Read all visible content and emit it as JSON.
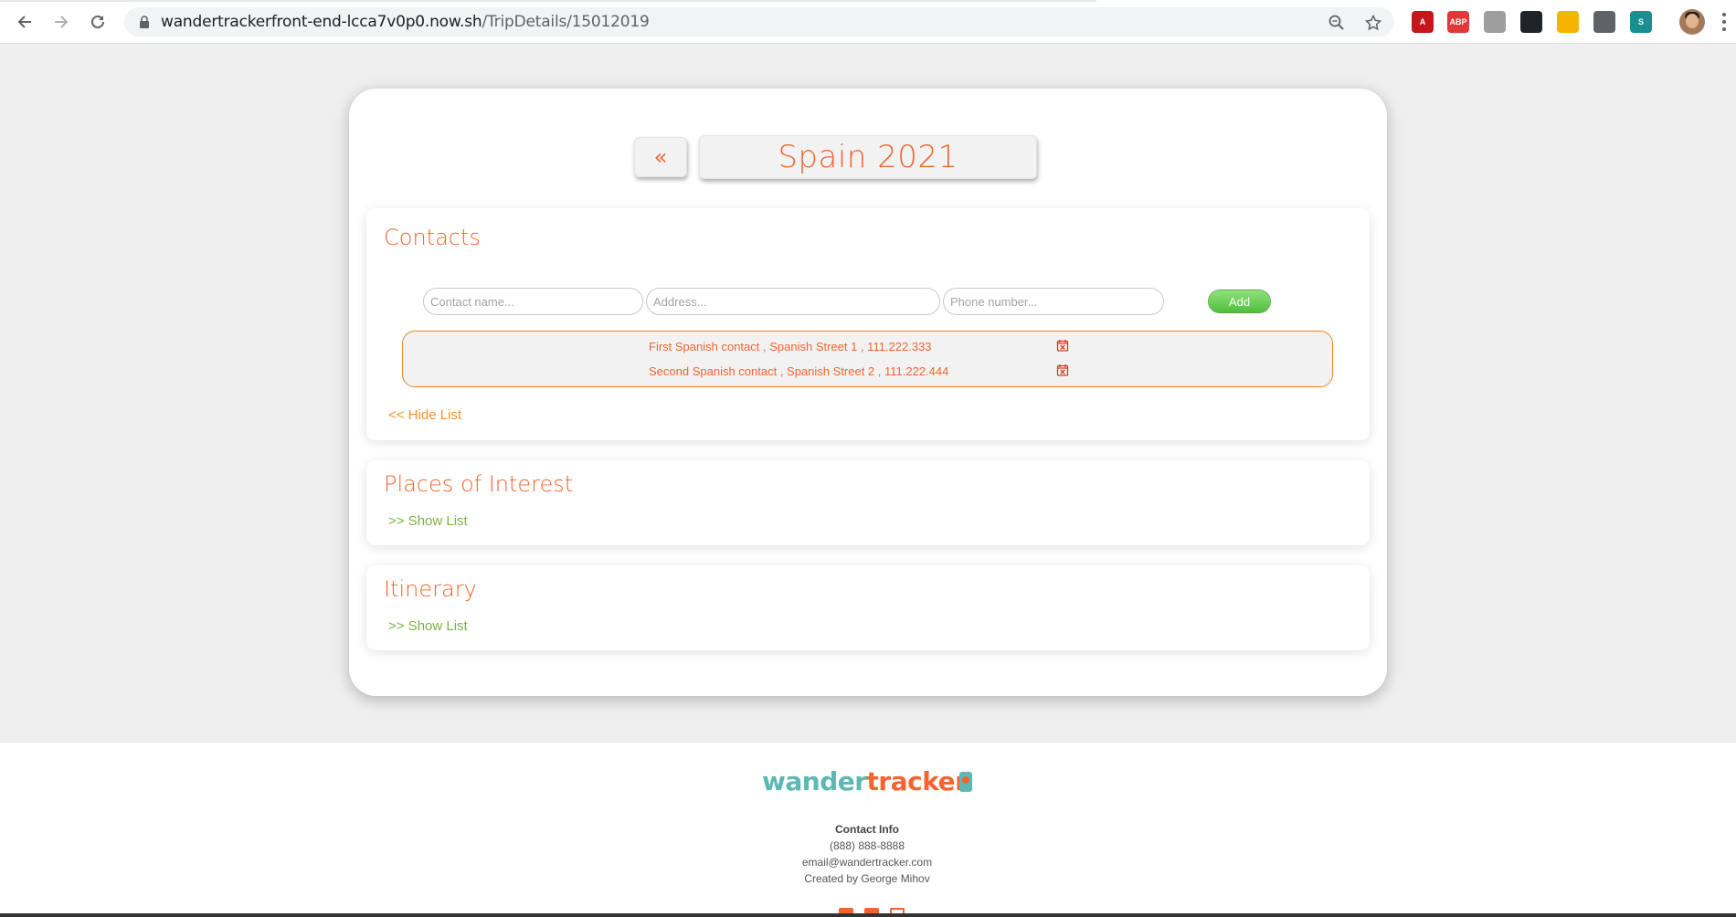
{
  "browser": {
    "url_host": "wandertrackerfront-end-lcca7v0p0.now.sh",
    "url_path": "/TripDetails/15012019",
    "extensions": [
      {
        "name": "pdf-extension-icon",
        "color": "#c4161c",
        "label": "A"
      },
      {
        "name": "adblock-plus-icon",
        "color": "#e03838",
        "label": "ABP"
      },
      {
        "name": "cube-extension-icon",
        "color": "#9e9e9e",
        "label": ""
      },
      {
        "name": "react-devtools-icon",
        "color": "#20232a",
        "label": ""
      },
      {
        "name": "color-picker-icon",
        "color": "#f4b400",
        "label": ""
      },
      {
        "name": "eyedropper-icon",
        "color": "#5f6368",
        "label": ""
      },
      {
        "name": "s-extension-icon",
        "color": "#1a8f8f",
        "label": "S"
      }
    ]
  },
  "trip": {
    "back_label": "«",
    "title": "Spain 2021"
  },
  "contacts": {
    "title": "Contacts",
    "name_placeholder": "Contact name...",
    "address_placeholder": "Address...",
    "phone_placeholder": "Phone number...",
    "add_label": "Add",
    "items": [
      {
        "text": "First Spanish contact , Spanish Street 1 , 111.222.333"
      },
      {
        "text": "Second Spanish contact , Spanish Street 2 , 111.222.444"
      }
    ],
    "toggle_label": "<< Hide List"
  },
  "places": {
    "title": "Places of Interest",
    "toggle_label": ">> Show List"
  },
  "itinerary": {
    "title": "Itinerary",
    "toggle_label": ">> Show List"
  },
  "footer": {
    "logo_part1": "wander",
    "logo_part2": "tracker",
    "contact_heading": "Contact Info",
    "phone": "(888) 888-8888",
    "email": "email@wandertracker.com",
    "credit": "Created by George Mihov"
  },
  "colors": {
    "accent": "#f26430",
    "secondary": "#f0932b",
    "green": "#7cb342",
    "brand_teal": "#5cb8b2"
  }
}
